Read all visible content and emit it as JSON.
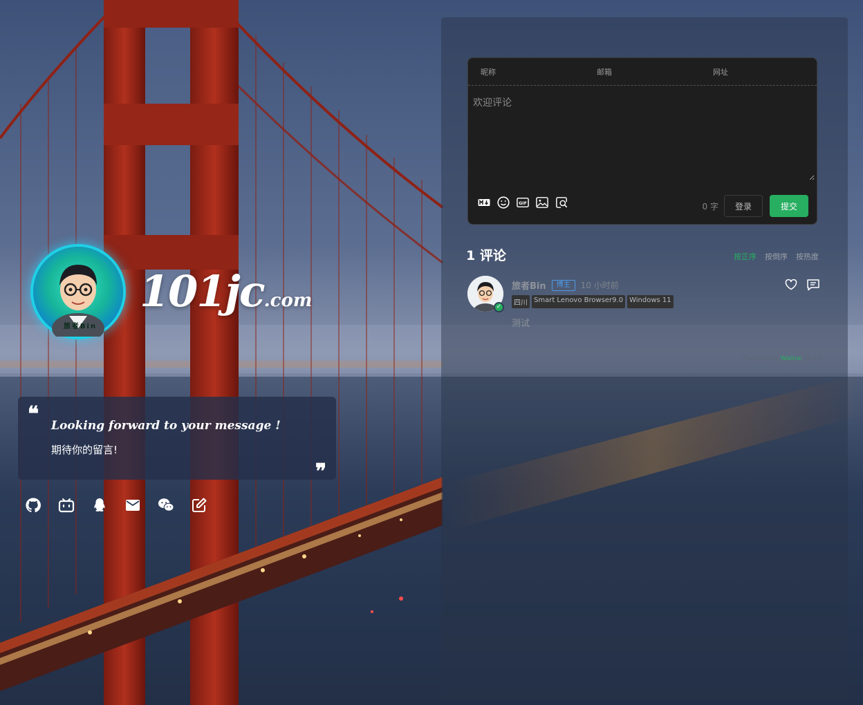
{
  "brand": {
    "site_name_main": "101jc",
    "site_name_tld": ".com",
    "avatar_caption": "旅者Bin"
  },
  "quote": {
    "open_mark": "❝",
    "close_mark": "❞",
    "english": "Looking forward to your message !",
    "chinese": "期待你的留言!"
  },
  "social_icons": [
    "github-icon",
    "bilibili-icon",
    "qq-icon",
    "mail-icon",
    "wechat-icon",
    "edit-icon"
  ],
  "editor": {
    "nick_placeholder": "昵称",
    "mail_placeholder": "邮箱",
    "link_placeholder": "网址",
    "content_placeholder": "欢迎评论",
    "tools": [
      "markdown-icon",
      "emoji-icon",
      "gif-icon",
      "image-icon",
      "preview-icon"
    ],
    "word_count": "0",
    "word_unit": "字",
    "login_label": "登录",
    "submit_label": "提交"
  },
  "comments_header": {
    "count_text": "1 评论",
    "sort": [
      "按正序",
      "按倒序",
      "按热度"
    ],
    "active_sort": 0
  },
  "comment": {
    "nick": "旅者Bin",
    "badge": "博主",
    "time": "10 小时前",
    "meta": [
      "四川",
      "Smart Lenovo Browser9.0",
      "Windows 11"
    ],
    "content": "测试"
  },
  "footer": {
    "powered_prefix": "Powered by",
    "powered_brand": "Waline",
    "powered_version": "v3.1.3"
  },
  "colors": {
    "accent": "#27ae60",
    "badge": "#4e9be6",
    "editor_bg": "#1e1e1e"
  }
}
